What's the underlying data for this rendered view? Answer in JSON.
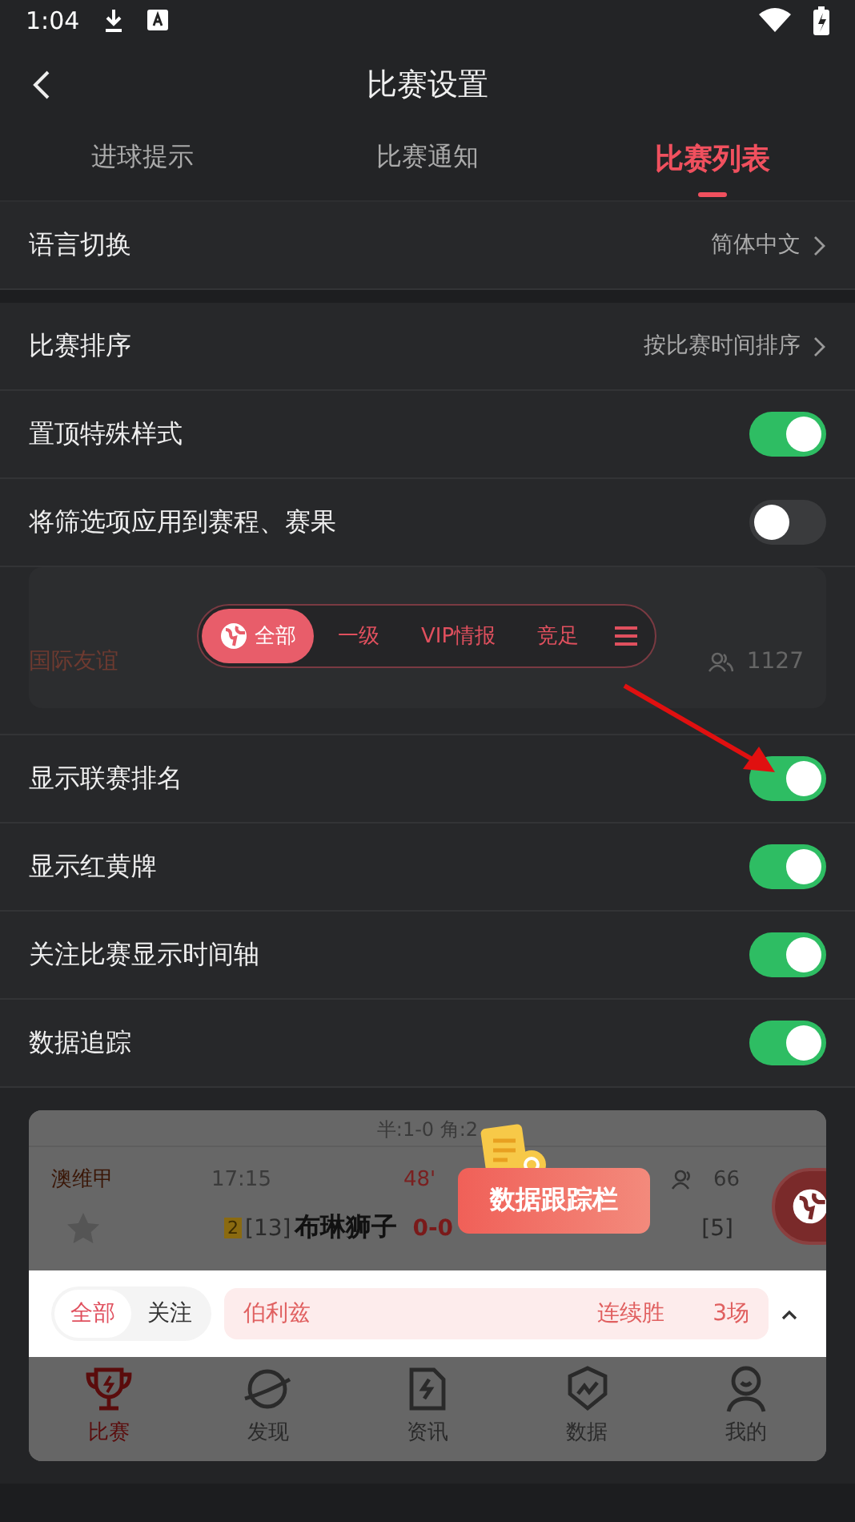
{
  "status_bar": {
    "time": "1:04"
  },
  "header": {
    "title": "比赛设置"
  },
  "tabs": [
    {
      "label": "进球提示",
      "selected": false
    },
    {
      "label": "比赛通知",
      "selected": false
    },
    {
      "label": "比赛列表",
      "selected": true
    }
  ],
  "sections": [
    {
      "items": [
        {
          "kind": "link",
          "label": "语言切换",
          "value": "简体中文"
        }
      ]
    },
    {
      "items": [
        {
          "kind": "link",
          "label": "比赛排序",
          "value": "按比赛时间排序"
        },
        {
          "kind": "toggle",
          "label": "置顶特殊样式",
          "on": true
        },
        {
          "kind": "toggle",
          "label": "将筛选项应用到赛程、赛果",
          "on": false
        },
        {
          "kind": "filter_preview",
          "league": "国际友谊",
          "viewers": "1127",
          "filters": [
            {
              "label": "全部",
              "selected": true
            },
            {
              "label": "一级",
              "selected": false
            },
            {
              "label": "VIP情报",
              "selected": false
            },
            {
              "label": "竞足",
              "selected": false
            }
          ]
        },
        {
          "kind": "toggle",
          "label": "显示联赛排名",
          "on": true
        },
        {
          "kind": "toggle",
          "label": "显示红黄牌",
          "on": true
        },
        {
          "kind": "toggle",
          "label": "关注比赛显示时间轴",
          "on": true
        },
        {
          "kind": "toggle",
          "label": "数据追踪",
          "on": true
        }
      ]
    }
  ],
  "tracking_preview": {
    "summary": "半:1-0 角:2",
    "league": "澳维甲",
    "time": "17:15",
    "minute": "48'",
    "viewers": "66",
    "yellow_cards": "2",
    "home_rank": "[13]",
    "home": "布琳狮子",
    "score": "0-0",
    "away_rank": "[5]",
    "tooltip": "数据跟踪栏",
    "segments": [
      {
        "label": "全部",
        "selected": true
      },
      {
        "label": "关注",
        "selected": false
      }
    ],
    "streak": {
      "team": "伯利兹",
      "type": "连续胜",
      "count": "3场"
    },
    "nav": [
      {
        "label": "比赛",
        "selected": true
      },
      {
        "label": "发现",
        "selected": false
      },
      {
        "label": "资讯",
        "selected": false
      },
      {
        "label": "数据",
        "selected": false
      },
      {
        "label": "我的",
        "selected": false
      }
    ]
  }
}
